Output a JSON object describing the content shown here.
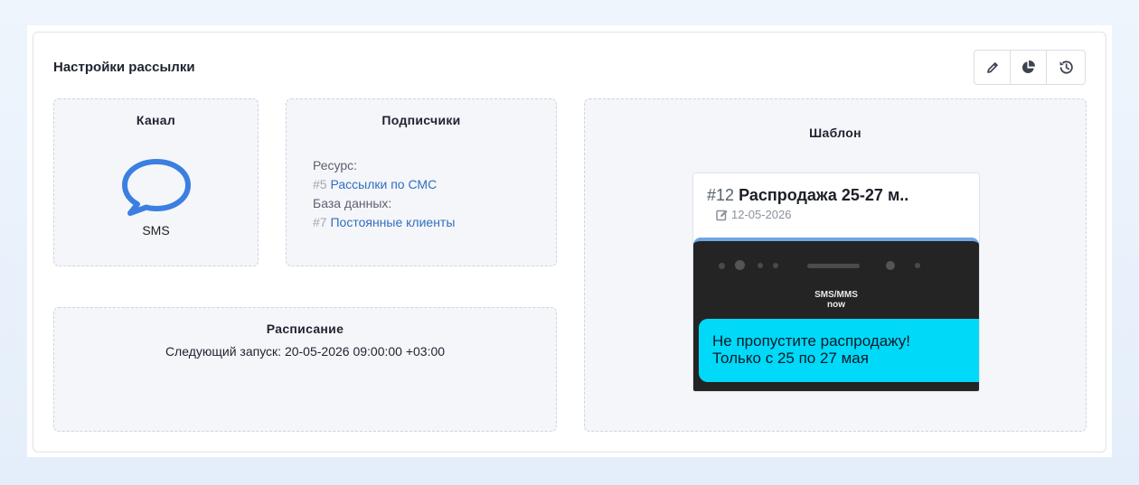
{
  "card": {
    "title": "Настройки рассылки"
  },
  "toolbar": {
    "edit_icon": "pencil-icon",
    "stats_icon": "pie-chart-icon",
    "history_icon": "history-icon"
  },
  "channel": {
    "title": "Канал",
    "icon": "chat-bubble-icon",
    "value": "SMS",
    "accent": "#3b7fe0"
  },
  "subscribers": {
    "title": "Подписчики",
    "resource_label": "Ресурс:",
    "resource_id": "#5",
    "resource_name": "Рассылки по СМС",
    "db_label": "База данных:",
    "db_id": "#7",
    "db_name": "Постоянные клиенты"
  },
  "schedule": {
    "title": "Расписание",
    "next_run": "Следующий запуск: 20-05-2026 09:00:00 +03:00"
  },
  "template": {
    "title": "Шаблон",
    "number": "#12",
    "name": "Распродажа 25-27 м..",
    "date": "12-05-2026",
    "preview": {
      "header_line1": "SMS/MMS",
      "header_line2": "now",
      "message_line1": "Не пропустите распродажу!",
      "message_line2": "Только с 25 по 27 мая",
      "bubble_color": "#00d9f7"
    }
  }
}
